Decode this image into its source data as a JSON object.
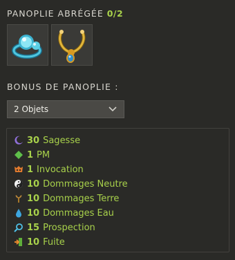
{
  "set": {
    "title": "PANOPLIE ABRÉGÉE",
    "count": "0/2",
    "items": [
      {
        "name": "ring-icon"
      },
      {
        "name": "amulet-icon"
      }
    ]
  },
  "bonus": {
    "title": "BONUS DE PANOPLIE :",
    "selected": "2 Objets",
    "rows": [
      {
        "icon": "wisdom-icon",
        "value": "30",
        "label": "Sagesse"
      },
      {
        "icon": "pm-icon",
        "value": "1",
        "label": "PM"
      },
      {
        "icon": "invocation-icon",
        "value": "1",
        "label": "Invocation"
      },
      {
        "icon": "neutral-icon",
        "value": "10",
        "label": "Dommages Neutre"
      },
      {
        "icon": "earth-icon",
        "value": "10",
        "label": "Dommages Terre"
      },
      {
        "icon": "water-icon",
        "value": "10",
        "label": "Dommages Eau"
      },
      {
        "icon": "prospection-icon",
        "value": "15",
        "label": "Prospection"
      },
      {
        "icon": "flee-icon",
        "value": "10",
        "label": "Fuite"
      }
    ]
  },
  "colors": {
    "background": "#2a2a27",
    "accent": "#a8d14b",
    "text": "#d8d6cf"
  }
}
